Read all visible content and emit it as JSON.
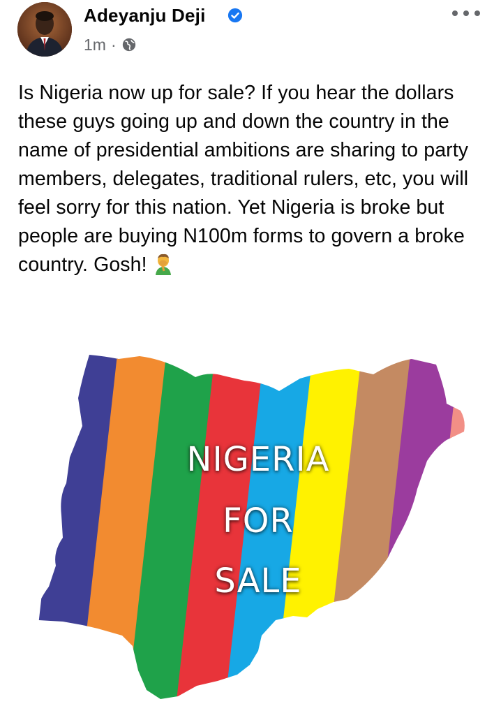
{
  "post": {
    "author_name": "Adeyanju Deji",
    "timestamp": "1m",
    "separator": "·",
    "privacy_icon": "globe-icon",
    "verified_icon": "verified-badge-icon",
    "more_icon": "more-options-icon",
    "text": "Is Nigeria now up for sale? If you hear the dollars these guys going up and down the country in the name of presidential ambitions are sharing to party members, delegates, traditional rulers, etc, you will feel sorry for this nation. Yet Nigeria is broke but people are buying N100m forms to govern a broke country. Gosh!",
    "emoji_icon": "man-facepalming-emoji"
  },
  "image": {
    "line1": "NIGERIA",
    "line2": "FOR",
    "line3": "SALE",
    "stripe_colors": [
      "#3f3f95",
      "#f28b30",
      "#1fa24a",
      "#e8343a",
      "#17a8e5",
      "#fff200",
      "#c48a62",
      "#9b3c9e",
      "#f28f86"
    ]
  },
  "colors": {
    "verified": "#1877f2",
    "meta_text": "#65676b",
    "body_text": "#050505"
  }
}
